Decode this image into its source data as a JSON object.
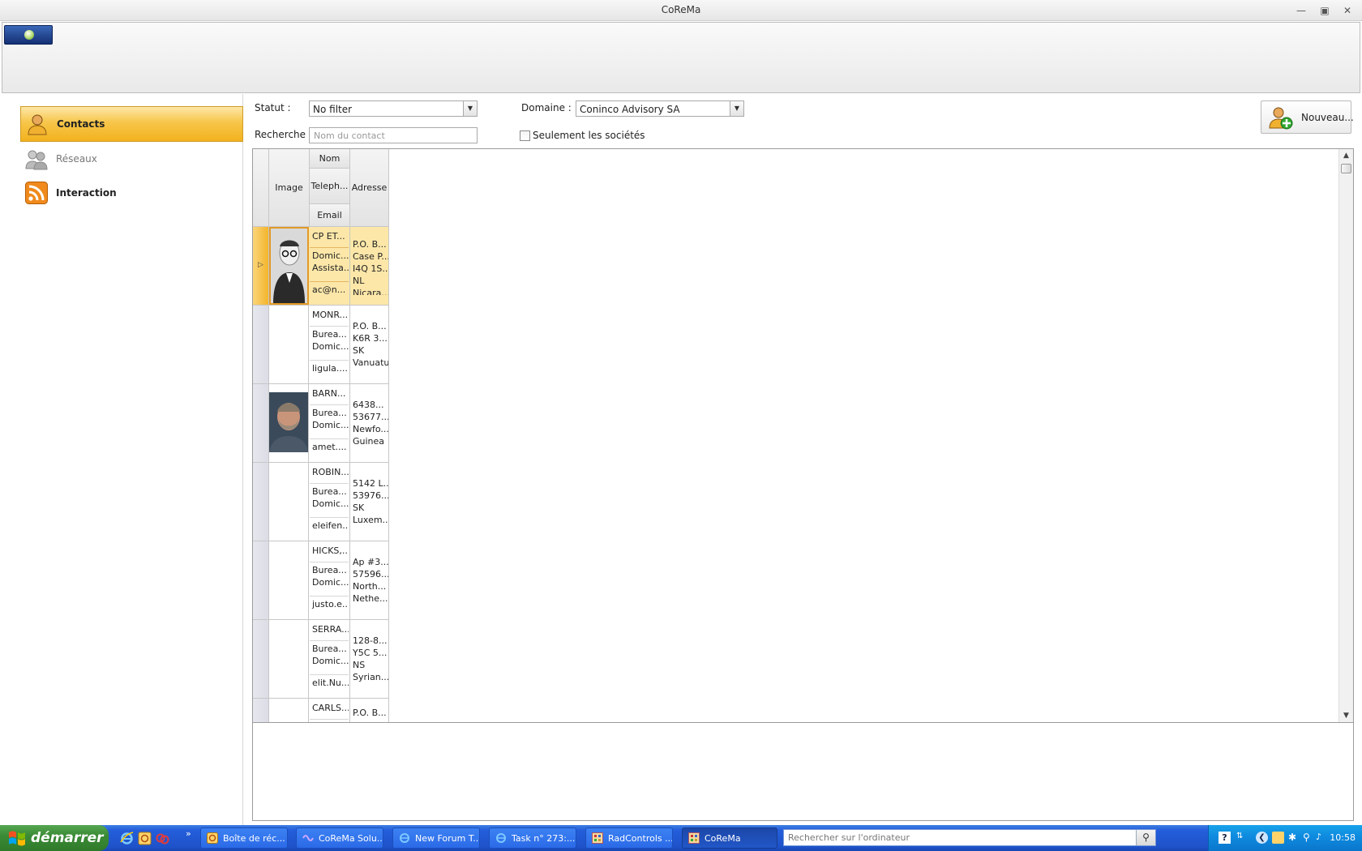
{
  "window": {
    "title": "CoReMa",
    "buttons": [
      "minimize-icon",
      "maximize-icon",
      "close-icon"
    ]
  },
  "nav": {
    "items": [
      {
        "label": "Contacts",
        "icon": "contacts-icon",
        "active": true
      },
      {
        "label": "Réseaux",
        "icon": "network-users-icon",
        "active": false
      },
      {
        "label": "Interaction",
        "icon": "rss-icon",
        "active": false
      }
    ]
  },
  "filters": {
    "statut_label": "Statut :",
    "statut_value": "No filter",
    "domaine_label": "Domaine :",
    "domaine_value": "Coninco Advisory SA",
    "recherche_label": "Recherche :",
    "recherche_placeholder": "Nom du contact",
    "societes_label": "Seulement les sociétés",
    "societes_checked": false,
    "new_button": "Nouveau..."
  },
  "grid": {
    "columns": {
      "image": "Image",
      "nom": "Nom",
      "telephone": "Teleph...",
      "email": "Email",
      "adresse": "Adresse"
    },
    "rows": [
      {
        "nom": "CP ET...",
        "tel1": "Domic...",
        "tel2": "Assista...",
        "email": "ac@n...",
        "adresse": [
          "P.O. B...",
          "Case P...",
          "I4Q 1S...",
          "NL",
          "Nicara..."
        ],
        "image": "photo-man-glasses",
        "selected": true
      },
      {
        "nom": "MONR...",
        "tel1": "Burea...",
        "tel2": "Domic...",
        "email": "ligula....",
        "adresse": [
          "P.O. B...",
          "K6R 3...",
          "SK",
          "Vanuatu"
        ],
        "image": "",
        "selected": false
      },
      {
        "nom": "BARN...",
        "tel1": "Burea...",
        "tel2": "Domic...",
        "email": "amet....",
        "adresse": [
          "6438...",
          "53677...",
          "Newfo...",
          "Guinea"
        ],
        "image": "photo-man-beard",
        "selected": false
      },
      {
        "nom": "ROBIN...",
        "tel1": "Burea...",
        "tel2": "Domic...",
        "email": "eleifen...",
        "adresse": [
          "5142 L...",
          "53976...",
          "SK",
          "Luxem..."
        ],
        "image": "",
        "selected": false
      },
      {
        "nom": "HICKS,...",
        "tel1": "Burea...",
        "tel2": "Domic...",
        "email": "justo.e...",
        "adresse": [
          "Ap #3...",
          "57596...",
          "North...",
          "Nethe..."
        ],
        "image": "",
        "selected": false
      },
      {
        "nom": "SERRA...",
        "tel1": "Burea...",
        "tel2": "Domic...",
        "email": "elit.Nu...",
        "adresse": [
          "128-8...",
          "Y5C 5...",
          "NS",
          "Syrian..."
        ],
        "image": "",
        "selected": false
      },
      {
        "nom": "CARLS...",
        "tel1": "",
        "tel2": "",
        "email": "",
        "adresse": [
          "",
          "P.O. B..."
        ],
        "image": "",
        "selected": false
      }
    ]
  },
  "taskbar": {
    "start_label": "démarrer",
    "tasks": [
      {
        "label": "Boîte de réc...",
        "icon": "outlook-icon",
        "active": false
      },
      {
        "label": "CoReMa Solu...",
        "icon": "visual-studio-icon",
        "active": false
      },
      {
        "label": "New Forum T...",
        "icon": "ie-icon",
        "active": false
      },
      {
        "label": "Task n° 273:...",
        "icon": "ie-icon",
        "active": false
      },
      {
        "label": "RadControls ...",
        "icon": "app-window-icon",
        "active": false
      },
      {
        "label": "CoReMa",
        "icon": "app-window-icon",
        "active": true
      }
    ],
    "search_placeholder": "Rechercher sur l'ordinateur",
    "clock": "10:58"
  }
}
